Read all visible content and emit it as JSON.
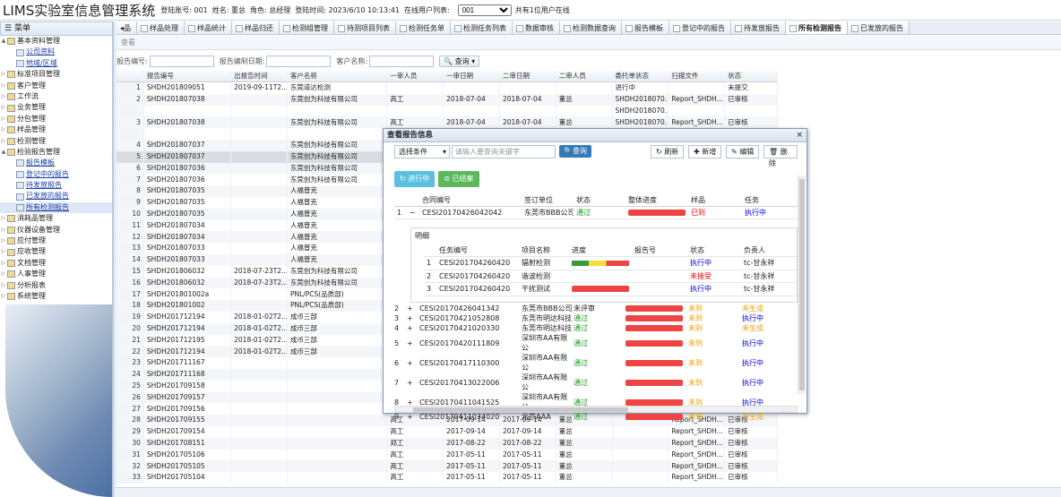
{
  "app": {
    "title": "LIMS实验室信息管理系统",
    "login_account": "登陆账号: 001",
    "user_name": "姓名: 董总",
    "role": "角色: 总经理",
    "login_time": "登陆时间: 2023/6/10 10:13:41",
    "online_label": "在线用户列表:",
    "online_select": "001",
    "online_count": "共有1位用户在线"
  },
  "menu": {
    "header": "菜单",
    "items": [
      {
        "label": "基本资料管理",
        "type": "parent",
        "arrow": "▲"
      },
      {
        "label": "公司资料",
        "type": "child"
      },
      {
        "label": "地域/区域",
        "type": "child"
      },
      {
        "label": "标准项目管理",
        "type": "parent",
        "arrow": "▷"
      },
      {
        "label": "客户管理",
        "type": "parent",
        "arrow": "▷"
      },
      {
        "label": "工作流",
        "type": "parent",
        "arrow": "▷"
      },
      {
        "label": "业务管理",
        "type": "parent",
        "arrow": "▷"
      },
      {
        "label": "分包管理",
        "type": "parent",
        "arrow": "▷"
      },
      {
        "label": "样品管理",
        "type": "parent",
        "arrow": "▷"
      },
      {
        "label": "检测管理",
        "type": "parent",
        "arrow": "▷"
      },
      {
        "label": "检验报告管理",
        "type": "parent",
        "arrow": "▲"
      },
      {
        "label": "报告模板",
        "type": "child"
      },
      {
        "label": "登记中的报告",
        "type": "child"
      },
      {
        "label": "待发放报告",
        "type": "child"
      },
      {
        "label": "已发放的报告",
        "type": "child"
      },
      {
        "label": "所有检测报告",
        "type": "child",
        "selected": true
      },
      {
        "label": "消耗品管理",
        "type": "parent",
        "arrow": "▷"
      },
      {
        "label": "仪器设备管理",
        "type": "parent",
        "arrow": "▷"
      },
      {
        "label": "应付管理",
        "type": "parent",
        "arrow": "▷"
      },
      {
        "label": "应收管理",
        "type": "parent",
        "arrow": "▷"
      },
      {
        "label": "文档管理",
        "type": "parent",
        "arrow": "▷"
      },
      {
        "label": "人事管理",
        "type": "parent",
        "arrow": "▷"
      },
      {
        "label": "分析报表",
        "type": "parent",
        "arrow": "▷"
      },
      {
        "label": "系统管理",
        "type": "parent",
        "arrow": "▷"
      }
    ]
  },
  "tabs": [
    {
      "label": "◂品"
    },
    {
      "label": "样品处理"
    },
    {
      "label": "样品统计"
    },
    {
      "label": "样品归还"
    },
    {
      "label": "检测组管理"
    },
    {
      "label": "待测项目列表"
    },
    {
      "label": "检测任务单"
    },
    {
      "label": "检测任务列表"
    },
    {
      "label": "数据审核"
    },
    {
      "label": "检测数据查询"
    },
    {
      "label": "报告模板"
    },
    {
      "label": "登记中的报告"
    },
    {
      "label": "待发放报告"
    },
    {
      "label": "所有检测报告",
      "active": true
    },
    {
      "label": "已发放的报告"
    }
  ],
  "toolbar": {
    "view": "查看"
  },
  "search": {
    "report_no": "报告编号:",
    "date": "报告编制日期:",
    "customer": "客户名称:",
    "query": "查询"
  },
  "grid": {
    "columns": [
      "",
      "报告编号",
      "出报告时间",
      "客户名称",
      "一审人员",
      "一审日期",
      "二审日期",
      "二审人员",
      "委托单状态",
      "扫描文件",
      "状态"
    ],
    "rows": [
      [
        "1",
        "SHDH201809051",
        "2019-09-11T2...",
        "东莞道达检测",
        "",
        "",
        "",
        "",
        "进行中",
        "",
        "未提交"
      ],
      [
        "2",
        "SHDH201807038",
        "",
        "东莞创为科技有限公司",
        "高工",
        "2018-07-04",
        "2018-07-04",
        "董总",
        "SHDH2018070...",
        "Report_SHDH...",
        "已审核"
      ],
      [
        "",
        "",
        "",
        "",
        "",
        "",
        "",
        "",
        "SHDH2018070...",
        "",
        ""
      ],
      [
        "3",
        "SHDH201807038",
        "",
        "东莞创为科技有限公司",
        "高工",
        "2018-07-04",
        "2018-07-04",
        "董总",
        "SHDH2018070...",
        "Report_SHDH...",
        "已审核"
      ],
      [
        "",
        "",
        "",
        "",
        "",
        "",
        "",
        "",
        "SHDH2018070...",
        "",
        ""
      ],
      [
        "4",
        "SHDH201807037",
        "",
        "东莞创为科技有限公司",
        "",
        "",
        "",
        "",
        "",
        "",
        ""
      ],
      [
        "5",
        "SHDH201807037",
        "",
        "东莞创为科技有限公司",
        "",
        "",
        "",
        "",
        "",
        "",
        ""
      ],
      [
        "6",
        "SHDH201807036",
        "",
        "东莞创为科技有限公司",
        "",
        "",
        "",
        "",
        "",
        "",
        ""
      ],
      [
        "7",
        "SHDH201807036",
        "",
        "东莞创为科技有限公司",
        "",
        "",
        "",
        "",
        "",
        "",
        ""
      ],
      [
        "8",
        "SHDH201807035",
        "",
        "人福普克",
        "",
        "",
        "",
        "",
        "",
        "",
        ""
      ],
      [
        "9",
        "SHDH201807035",
        "",
        "人福普克",
        "",
        "",
        "",
        "",
        "",
        "",
        ""
      ],
      [
        "10",
        "SHDH201807035",
        "",
        "人福普克",
        "",
        "",
        "",
        "",
        "",
        "",
        ""
      ],
      [
        "11",
        "SHDH201807034",
        "",
        "人福普克",
        "",
        "",
        "",
        "",
        "",
        "",
        ""
      ],
      [
        "12",
        "SHDH201807034",
        "",
        "人福普克",
        "",
        "",
        "",
        "",
        "",
        "",
        ""
      ],
      [
        "13",
        "SHDH201807033",
        "",
        "人福普克",
        "",
        "",
        "",
        "",
        "",
        "",
        ""
      ],
      [
        "14",
        "SHDH201807033",
        "",
        "人福普克",
        "",
        "",
        "",
        "",
        "",
        "",
        ""
      ],
      [
        "15",
        "SHDH201806032",
        "2018-07-23T2...",
        "东莞创为科技有限公司",
        "",
        "",
        "",
        "",
        "",
        "",
        ""
      ],
      [
        "16",
        "SHDH201806032",
        "2018-07-23T2...",
        "东莞创为科技有限公司",
        "",
        "",
        "",
        "",
        "",
        "",
        ""
      ],
      [
        "17",
        "SHDH201801002a",
        "",
        "PNL/PCS(品质部)",
        "",
        "",
        "",
        "",
        "",
        "",
        ""
      ],
      [
        "18",
        "SHDH201801002",
        "",
        "PNL/PCS(品质部)",
        "",
        "",
        "",
        "",
        "",
        "",
        ""
      ],
      [
        "19",
        "SHDH201712194",
        "2018-01-02T2...",
        "成币三部",
        "",
        "",
        "",
        "",
        "",
        "",
        ""
      ],
      [
        "20",
        "SHDH201712194",
        "2018-01-02T2...",
        "成币三部",
        "",
        "",
        "",
        "",
        "",
        "",
        ""
      ],
      [
        "21",
        "SHDH201712195",
        "2018-01-02T2...",
        "成币三部",
        "",
        "",
        "",
        "",
        "",
        "",
        ""
      ],
      [
        "22",
        "SHDH201712194",
        "2018-01-02T2...",
        "成币三部",
        "",
        "",
        "",
        "",
        "",
        "",
        ""
      ],
      [
        "23",
        "SHDH201711167",
        "",
        "",
        "",
        "",
        "",
        "",
        "",
        "",
        ""
      ],
      [
        "24",
        "SHDH201711168",
        "",
        "",
        "",
        "",
        "",
        "",
        "",
        "",
        ""
      ],
      [
        "25",
        "SHDH201709158",
        "",
        "",
        "",
        "",
        "",
        "",
        "",
        "",
        ""
      ],
      [
        "26",
        "SHDH201709157",
        "",
        "",
        "",
        "",
        "",
        "",
        "",
        "",
        ""
      ],
      [
        "27",
        "SHDH201709156",
        "",
        "",
        "",
        "",
        "",
        "",
        "",
        "",
        ""
      ],
      [
        "28",
        "SHDH201709155",
        "",
        "",
        "高工",
        "2017-09-14",
        "2017-09-14",
        "董总",
        "",
        "Report_SHDH...",
        "已审核"
      ],
      [
        "29",
        "SHDH201709154",
        "",
        "",
        "高工",
        "2017-09-14",
        "2017-09-14",
        "董总",
        "",
        "Report_SHDH...",
        "已审核"
      ],
      [
        "30",
        "SHDH201708151",
        "",
        "",
        "郑工",
        "2017-08-22",
        "2017-08-22",
        "董总",
        "",
        "Report_SHDH...",
        "已审核"
      ],
      [
        "31",
        "SHDH201705106",
        "",
        "",
        "高工",
        "2017-05-11",
        "2017-05-11",
        "董总",
        "",
        "Report_SHDH...",
        "已审核"
      ],
      [
        "32",
        "SHDH201705105",
        "",
        "",
        "高工",
        "2017-05-11",
        "2017-05-11",
        "董总",
        "",
        "Report_SHDH...",
        "已审核"
      ],
      [
        "33",
        "SHDH201705104",
        "",
        "",
        "高工",
        "2017-05-11",
        "2017-05-11",
        "董总",
        "",
        "Report_SHDH...",
        "已审核"
      ]
    ]
  },
  "dialog": {
    "title": "查看报告信息",
    "close": "×",
    "select_label": "选择条件",
    "keyword_placeholder": "请输入要查询关键字",
    "query": "查询",
    "refresh": "刷新",
    "add": "新增",
    "edit": "编辑",
    "delete": "删除",
    "status_running": "进行中",
    "status_done": "已结案",
    "columns": [
      "",
      "",
      "合同编号",
      "签订单位",
      "状态",
      "整体进度",
      "样品",
      "任务"
    ],
    "first_row": {
      "no": "1",
      "toggle": "−",
      "contract": "CESI20170426042042",
      "unit": "东莞市BBB公司",
      "status": "通过",
      "sample": "已到",
      "task": "执行中"
    },
    "detail": {
      "label": "明细",
      "columns": [
        "",
        "任务编号",
        "项目名称",
        "进度",
        "报告号",
        "状态",
        "负责人"
      ],
      "rows": [
        {
          "no": "1",
          "task": "CESI201704260420",
          "project": "辐射检测",
          "report": "",
          "status": "执行中",
          "owner": "tc-甘永祥"
        },
        {
          "no": "2",
          "task": "CESI201704260420",
          "project": "谐波检测",
          "report": "",
          "status": "未接受",
          "owner": "tc-甘永祥"
        },
        {
          "no": "3",
          "task": "CESI201704260420",
          "project": "干扰测试",
          "report": "",
          "status": "执行中",
          "owner": "tc-甘永祥"
        }
      ]
    },
    "rows": [
      {
        "no": "2",
        "toggle": "+",
        "contract": "CESI20170426041342",
        "unit": "东莞市BBB公司",
        "status": "未评审",
        "sample": "未到",
        "task": "未生成"
      },
      {
        "no": "3",
        "toggle": "+",
        "contract": "CESI20170421052808",
        "unit": "东莞市明达科技",
        "status": "通过",
        "sample": "未到",
        "task": "执行中"
      },
      {
        "no": "4",
        "toggle": "+",
        "contract": "CESI20170421020330",
        "unit": "东莞市明达科技",
        "status": "通过",
        "sample": "未到",
        "task": "未生成"
      },
      {
        "no": "5",
        "toggle": "+",
        "contract": "CESI20170420111809",
        "unit": "深圳市AA有限公",
        "status": "通过",
        "sample": "未到",
        "task": "执行中"
      },
      {
        "no": "6",
        "toggle": "+",
        "contract": "CESI20170417110300",
        "unit": "深圳市AA有限公",
        "status": "通过",
        "sample": "未到",
        "task": "执行中"
      },
      {
        "no": "7",
        "toggle": "+",
        "contract": "CESI20170413022006",
        "unit": "深圳市AA有限公",
        "status": "通过",
        "sample": "未到",
        "task": "执行中"
      },
      {
        "no": "8",
        "toggle": "+",
        "contract": "CESI20170411041525",
        "unit": "深圳市AA有限公",
        "status": "通过",
        "sample": "未到",
        "task": "执行中"
      },
      {
        "no": "9",
        "toggle": "+",
        "contract": "CESI20170411034020",
        "unit": "北京AAA",
        "status": "通过",
        "sample": "未到",
        "task": "未生成"
      }
    ]
  },
  "colors": {
    "red": "#ee4444",
    "green": "#1a9a1a",
    "blue": "#0000d9",
    "orange": "#f0a000",
    "primary": "#337ab7"
  }
}
